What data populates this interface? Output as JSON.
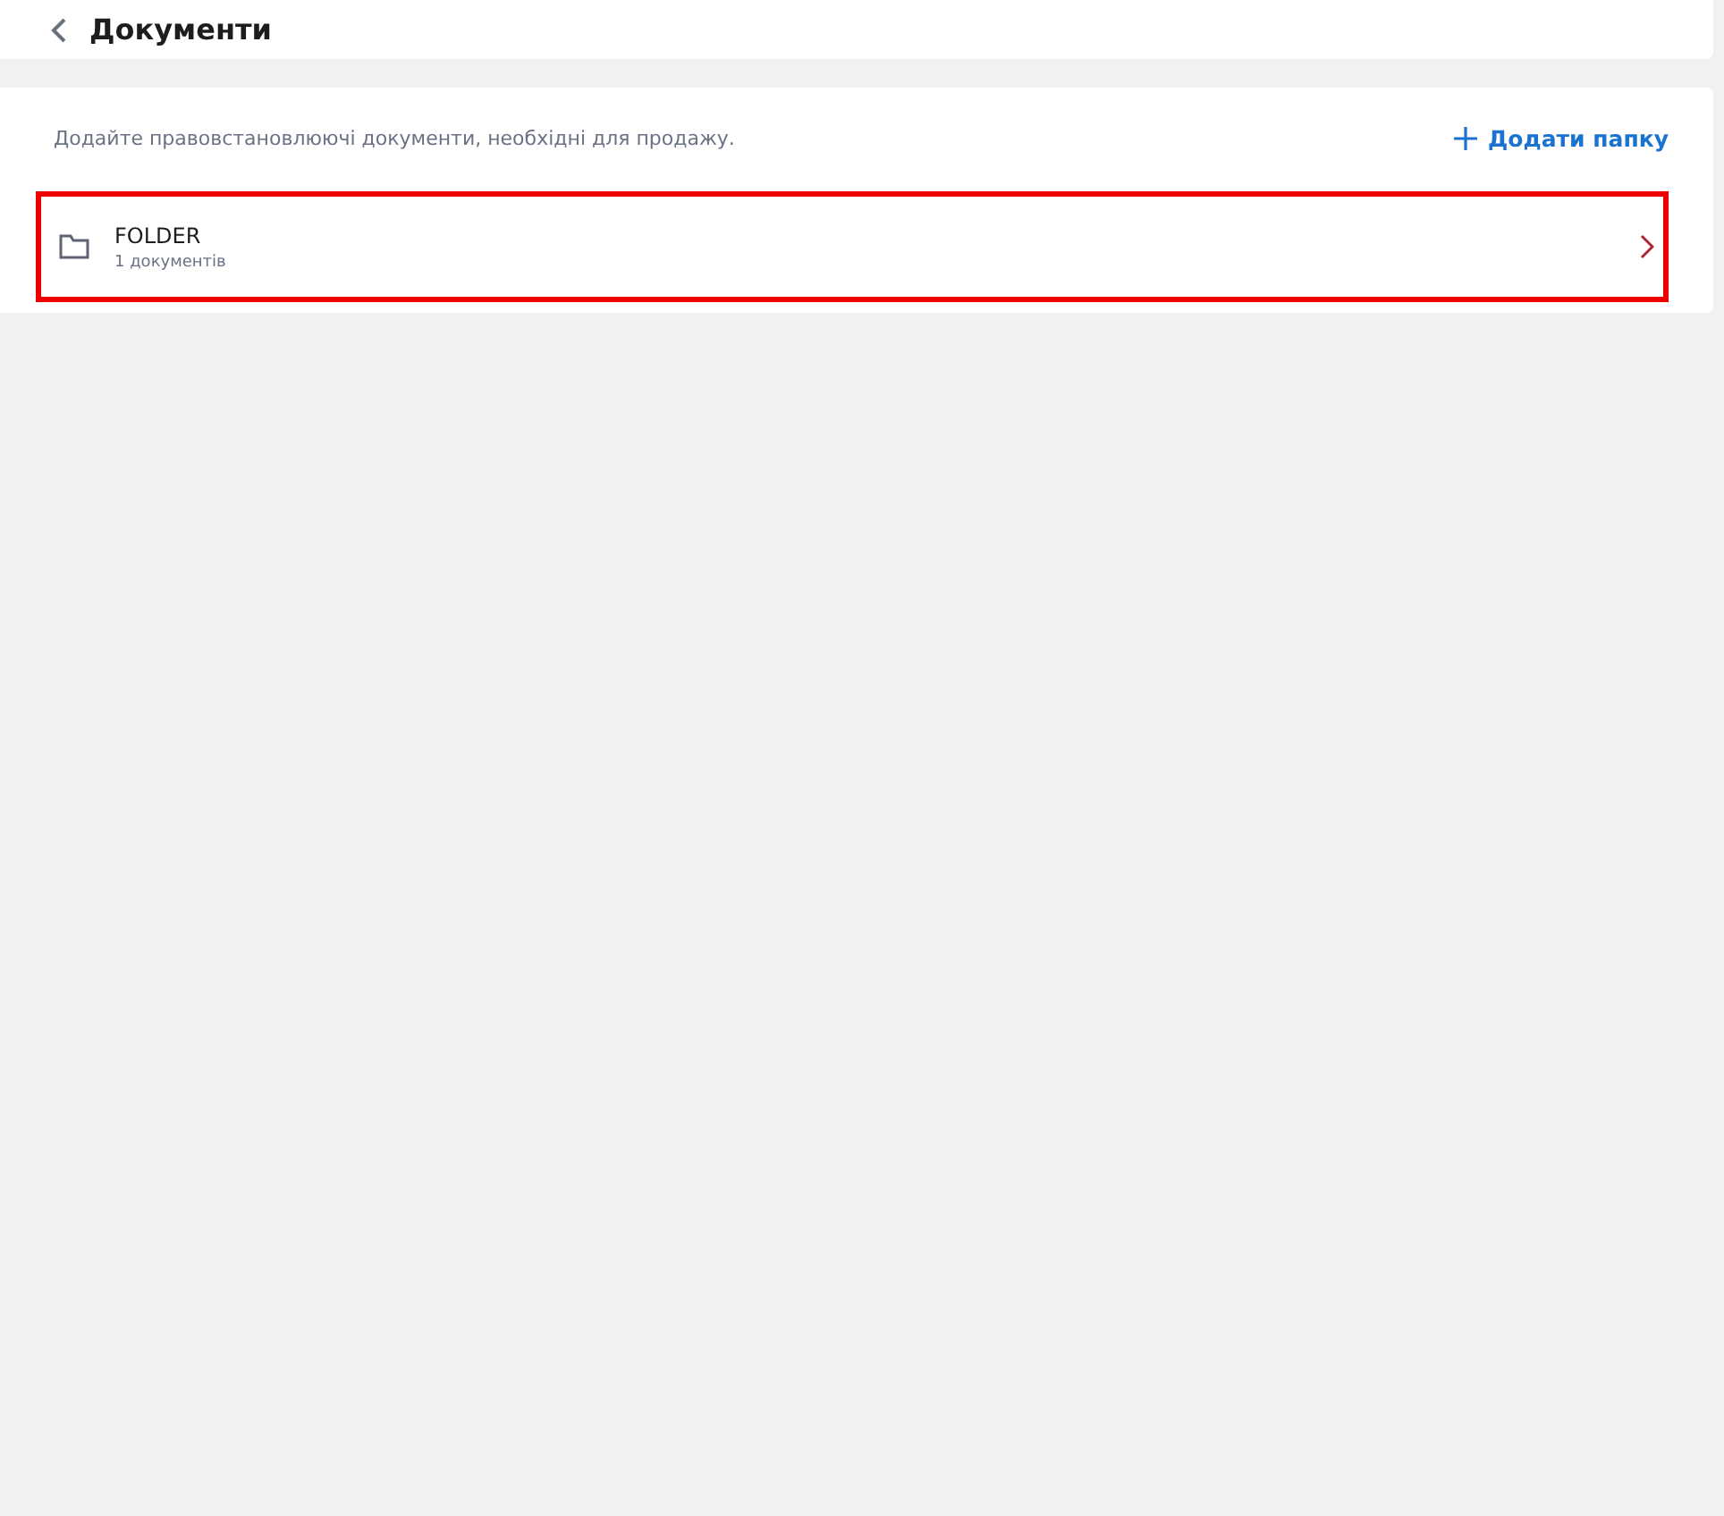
{
  "header": {
    "title": "Документи"
  },
  "description": "Додайте правовстановлюючі документи, необхідні для продажу.",
  "add_button": {
    "label": "Додати папку"
  },
  "folders": [
    {
      "name": "FOLDER",
      "count": "1 документів",
      "highlighted": true
    }
  ]
}
